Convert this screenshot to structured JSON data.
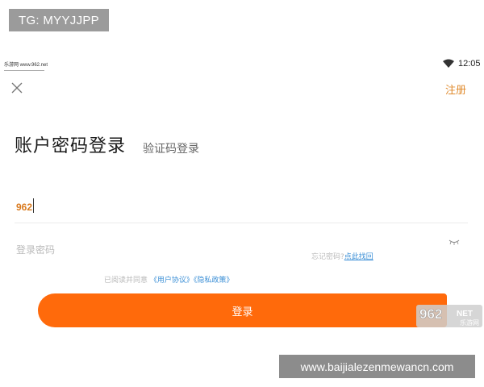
{
  "overlay_tag": "TG: MYYJJPP",
  "status_bar": {
    "site_logo": "乐游网 www.962.net",
    "time": "12:05"
  },
  "header": {
    "register_label": "注册"
  },
  "tabs": {
    "active": "账户密码登录",
    "inactive": "验证码登录"
  },
  "form": {
    "account_value": "962",
    "password_placeholder": "登录密码",
    "forgot_prefix": "忘记密码?",
    "forgot_link": "点此找回"
  },
  "agreement": {
    "prefix": "已阅读并同意",
    "user_agreement": "《用户协议》",
    "privacy_policy": "《隐私政策》"
  },
  "login_label": "登录",
  "watermark_962": {
    "logo": "962",
    "net": "NET",
    "sub": "乐游网"
  },
  "site_watermark": "www.baijialezenmewancn.com",
  "colors": {
    "accent": "#ff6a0b",
    "register": "#e08a2c",
    "link": "#3b8fd6"
  }
}
